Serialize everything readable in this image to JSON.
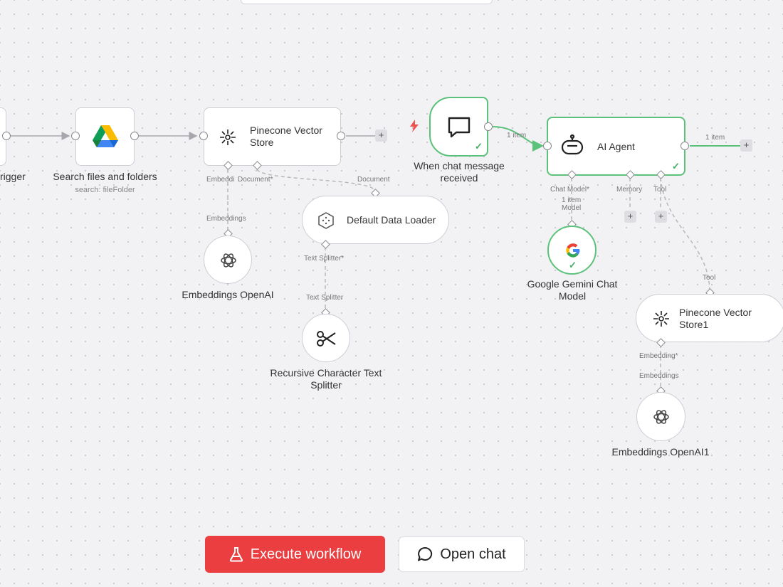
{
  "nodes": {
    "trigger": {
      "label": "rigger"
    },
    "search_files": {
      "label": "Search files and folders",
      "subtitle": "search: fileFolder",
      "icon": "google-drive-icon"
    },
    "pinecone_store": {
      "title": "Pinecone Vector Store",
      "icon": "pinecone-icon"
    },
    "chat_trigger": {
      "label": "When chat message received",
      "icon": "chat-bubble-icon"
    },
    "ai_agent": {
      "title": "AI Agent",
      "icon": "robot-icon"
    },
    "default_loader": {
      "title": "Default Data Loader",
      "icon": "hexagon-icon"
    },
    "embeddings_openai": {
      "label": "Embeddings OpenAI",
      "icon": "openai-icon"
    },
    "text_splitter": {
      "label": "Recursive Character Text Splitter",
      "icon": "scissors-icon"
    },
    "gemini": {
      "label": "Google Gemini Chat Model",
      "icon": "google-icon"
    },
    "pinecone_store1": {
      "title": "Pinecone Vector Store1",
      "icon": "pinecone-icon"
    },
    "embeddings_openai1": {
      "label": "Embeddings OpenAI1",
      "icon": "openai-icon"
    }
  },
  "connections": {
    "one_item": "1 item",
    "one_item_out": "1 item",
    "embeddi": "Embeddi",
    "document_req": "Document*",
    "document": "Document",
    "embeddings": "Embeddings",
    "text_splitter_req": "Text Splitter*",
    "text_splitter": "Text Splitter",
    "chat_model_req": "Chat Model*",
    "chat_model_items": "1 item",
    "chat_model_sub": "Model",
    "memory": "Memory",
    "tool": "Tool",
    "tool_in": "Tool",
    "embedding_req": "Embedding*",
    "embeddings2": "Embeddings"
  },
  "toolbar": {
    "execute_label": "Execute workflow",
    "open_chat_label": "Open chat"
  },
  "colors": {
    "execute": "#ea3e40",
    "success": "#5cc27b",
    "edge": "#a8a7ad",
    "trigger_bolt": "#ef5350"
  }
}
